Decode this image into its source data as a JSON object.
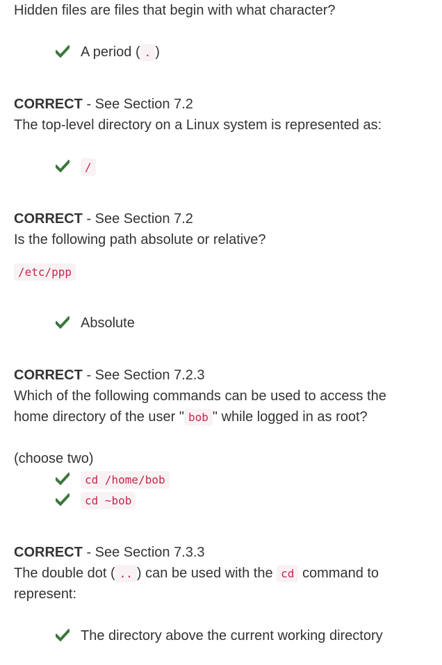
{
  "questions": [
    {
      "text": "Hidden files are files that begin with what character?",
      "answers": [
        {
          "before": "A period (",
          "code": ".",
          "after": ")"
        }
      ]
    },
    {
      "result_label": "CORRECT",
      "result_ref": " - See Section 7.2",
      "text": "The top-level directory on a Linux system is represented as:",
      "answers": [
        {
          "code": "/"
        }
      ]
    },
    {
      "result_label": "CORRECT",
      "result_ref": " - See Section 7.2",
      "text": "Is the following path absolute or relative?",
      "code_block": "/etc/ppp",
      "answers": [
        {
          "text": "Absolute"
        }
      ]
    },
    {
      "result_label": "CORRECT",
      "result_ref": " - See Section 7.2.3",
      "text_line1": "Which of the following commands can be used to access the",
      "text_line2_before": "home directory of the user \"",
      "text_line2_code": "bob",
      "text_line2_after": "\" while logged in as root?",
      "note": "(choose two)",
      "answers": [
        {
          "code": "cd /home/bob"
        },
        {
          "code": "cd ~bob"
        }
      ]
    },
    {
      "result_label": "CORRECT",
      "result_ref": " - See Section 7.3.3",
      "text_line1_before": "The double dot (",
      "text_line1_code1": "..",
      "text_line1_mid": ") can be used with the",
      "text_line1_code2": "cd",
      "text_line1_after": "command to",
      "text_line2": "represent:",
      "answers": [
        {
          "text": "The directory above the current working directory"
        }
      ]
    }
  ],
  "colors": {
    "text": "#333333",
    "check": "#3c763d",
    "code_text": "#c7254e",
    "code_bg": "#f9f2f4"
  },
  "icons": {
    "check": "check-icon"
  }
}
